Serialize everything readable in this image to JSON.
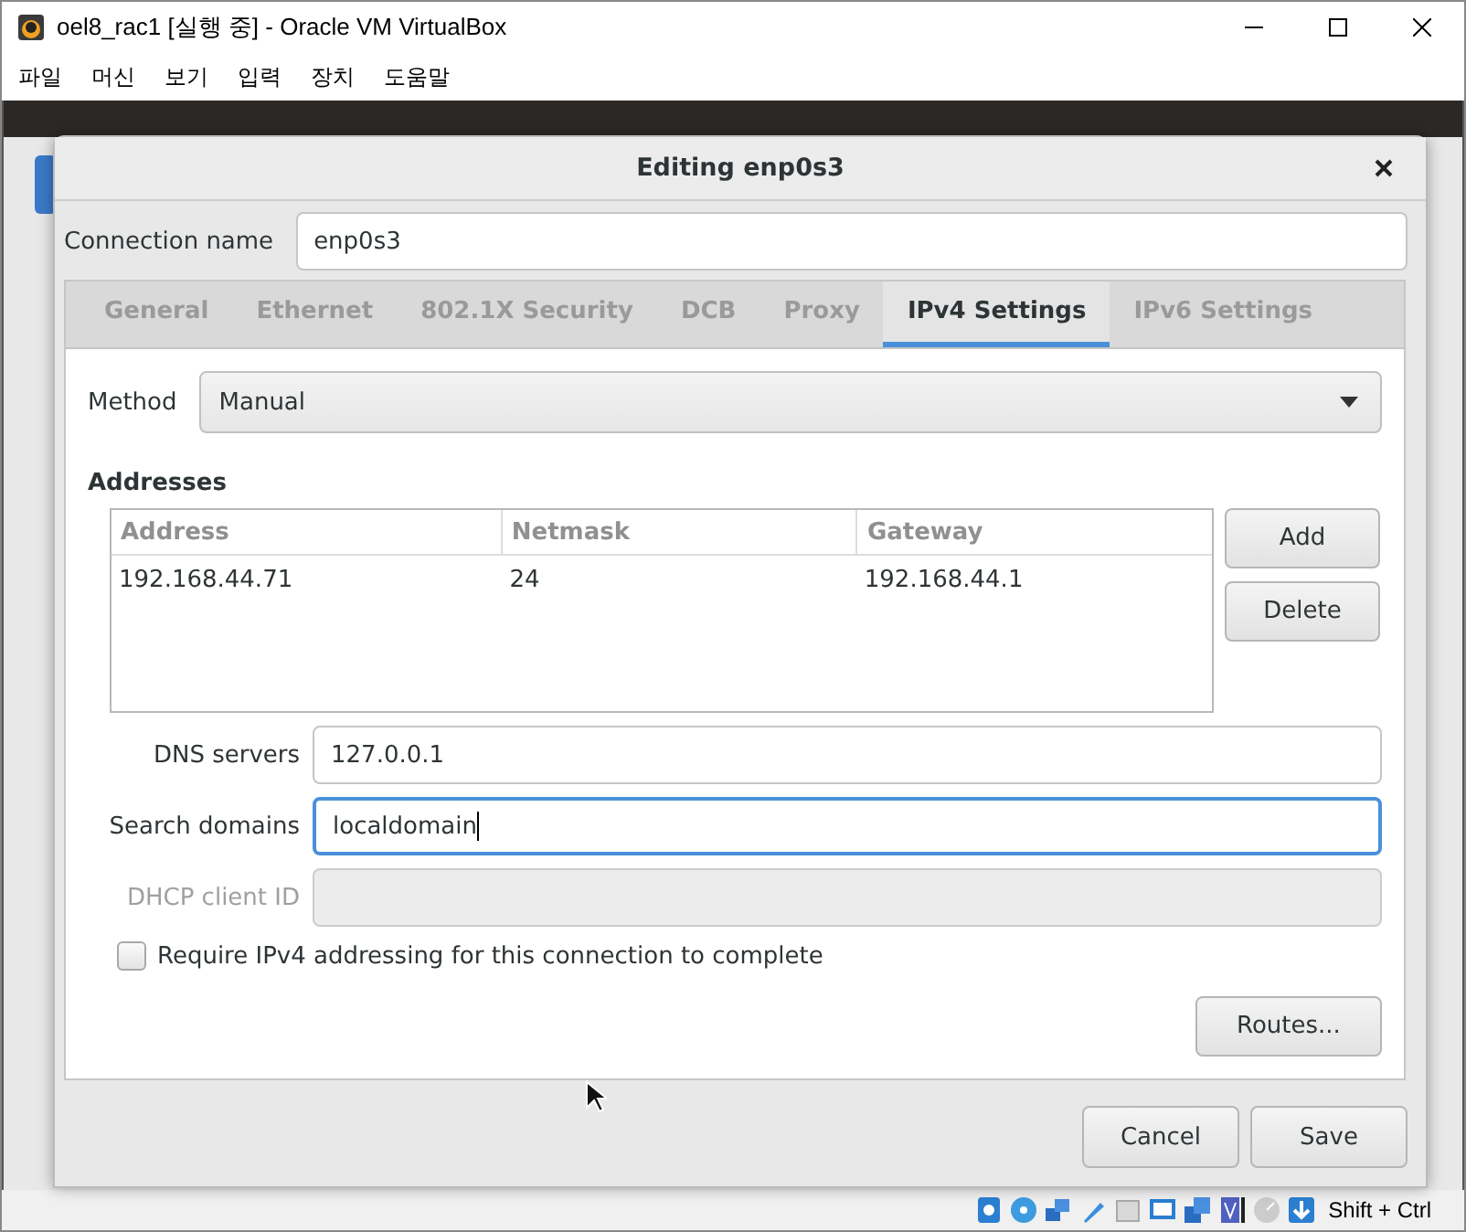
{
  "window": {
    "title": "oel8_rac1 [실행 중] - Oracle VM VirtualBox"
  },
  "menu": [
    "파일",
    "머신",
    "보기",
    "입력",
    "장치",
    "도움말"
  ],
  "dialog": {
    "title": "Editing enp0s3",
    "connection_name_label": "Connection name",
    "connection_name": "enp0s3",
    "tabs": [
      {
        "label": "General",
        "selected": false
      },
      {
        "label": "Ethernet",
        "selected": false
      },
      {
        "label": "802.1X Security",
        "selected": false
      },
      {
        "label": "DCB",
        "selected": false
      },
      {
        "label": "Proxy",
        "selected": false
      },
      {
        "label": "IPv4 Settings",
        "selected": true
      },
      {
        "label": "IPv6 Settings",
        "selected": false
      }
    ],
    "method_label": "Method",
    "method": "Manual",
    "addresses_heading": "Addresses",
    "columns": [
      "Address",
      "Netmask",
      "Gateway"
    ],
    "rows": [
      [
        "192.168.44.71",
        "24",
        "192.168.44.1"
      ]
    ],
    "side_buttons": [
      "Add",
      "Delete"
    ],
    "fields": [
      {
        "label": "DNS servers",
        "value": "127.0.0.1",
        "focused": false,
        "disabled": false
      },
      {
        "label": "Search domains",
        "value": "localdomain",
        "focused": true,
        "disabled": false
      },
      {
        "label": "DHCP client ID",
        "focused": false,
        "disabled": true
      }
    ],
    "require": {
      "label": "Require IPv4 addressing for this connection to complete",
      "checked": false
    },
    "routes_button": "Routes...",
    "buttons": [
      "Cancel",
      "Save"
    ]
  },
  "status_bar": {
    "host_key": "Shift + Ctrl"
  }
}
